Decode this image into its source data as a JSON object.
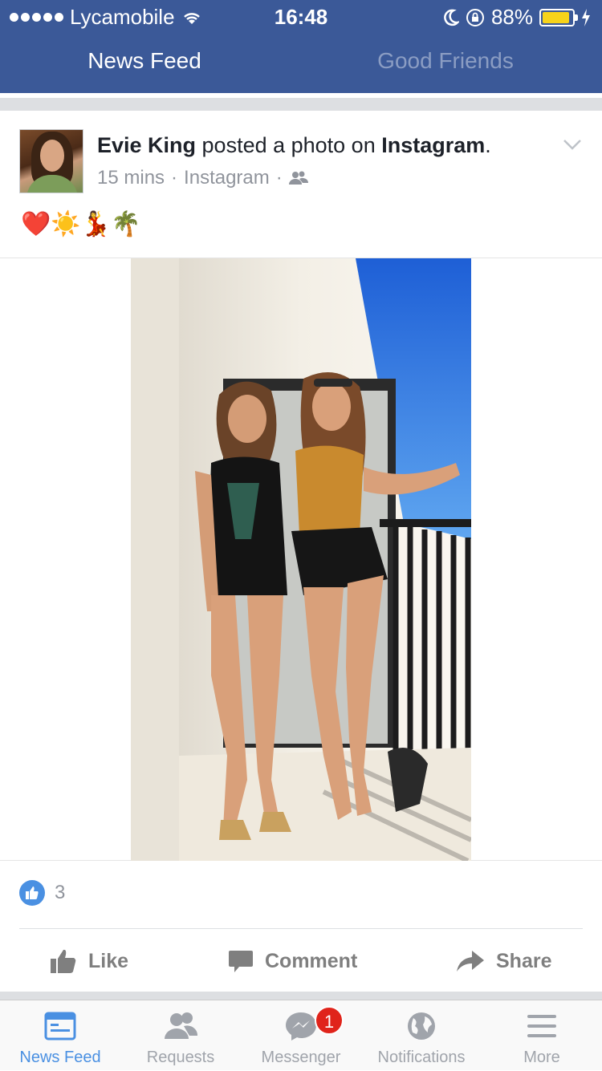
{
  "status_bar": {
    "carrier": "Lycamobile",
    "time": "16:48",
    "battery_percent": "88%",
    "battery_level": 0.88
  },
  "top_tabs": [
    {
      "label": "News Feed",
      "active": true
    },
    {
      "label": "Good Friends",
      "active": false
    }
  ],
  "post": {
    "author": "Evie King",
    "action_text": " posted a photo on ",
    "platform": "Instagram",
    "period": ".",
    "time": "15 mins",
    "meta_sep": "·",
    "source": "Instagram",
    "emojis": "❤️☀️💃🌴",
    "like_count": "3"
  },
  "actions": {
    "like": "Like",
    "comment": "Comment",
    "share": "Share"
  },
  "tabbar": [
    {
      "label": "News Feed",
      "icon": "news-feed-icon",
      "active": true
    },
    {
      "label": "Requests",
      "icon": "friends-icon",
      "active": false
    },
    {
      "label": "Messenger",
      "icon": "messenger-icon",
      "active": false,
      "badge": "1"
    },
    {
      "label": "Notifications",
      "icon": "globe-icon",
      "active": false
    },
    {
      "label": "More",
      "icon": "menu-icon",
      "active": false
    }
  ],
  "colors": {
    "brand": "#3b5998",
    "active_tab": "#4a90e2",
    "badge": "#e0241b"
  }
}
